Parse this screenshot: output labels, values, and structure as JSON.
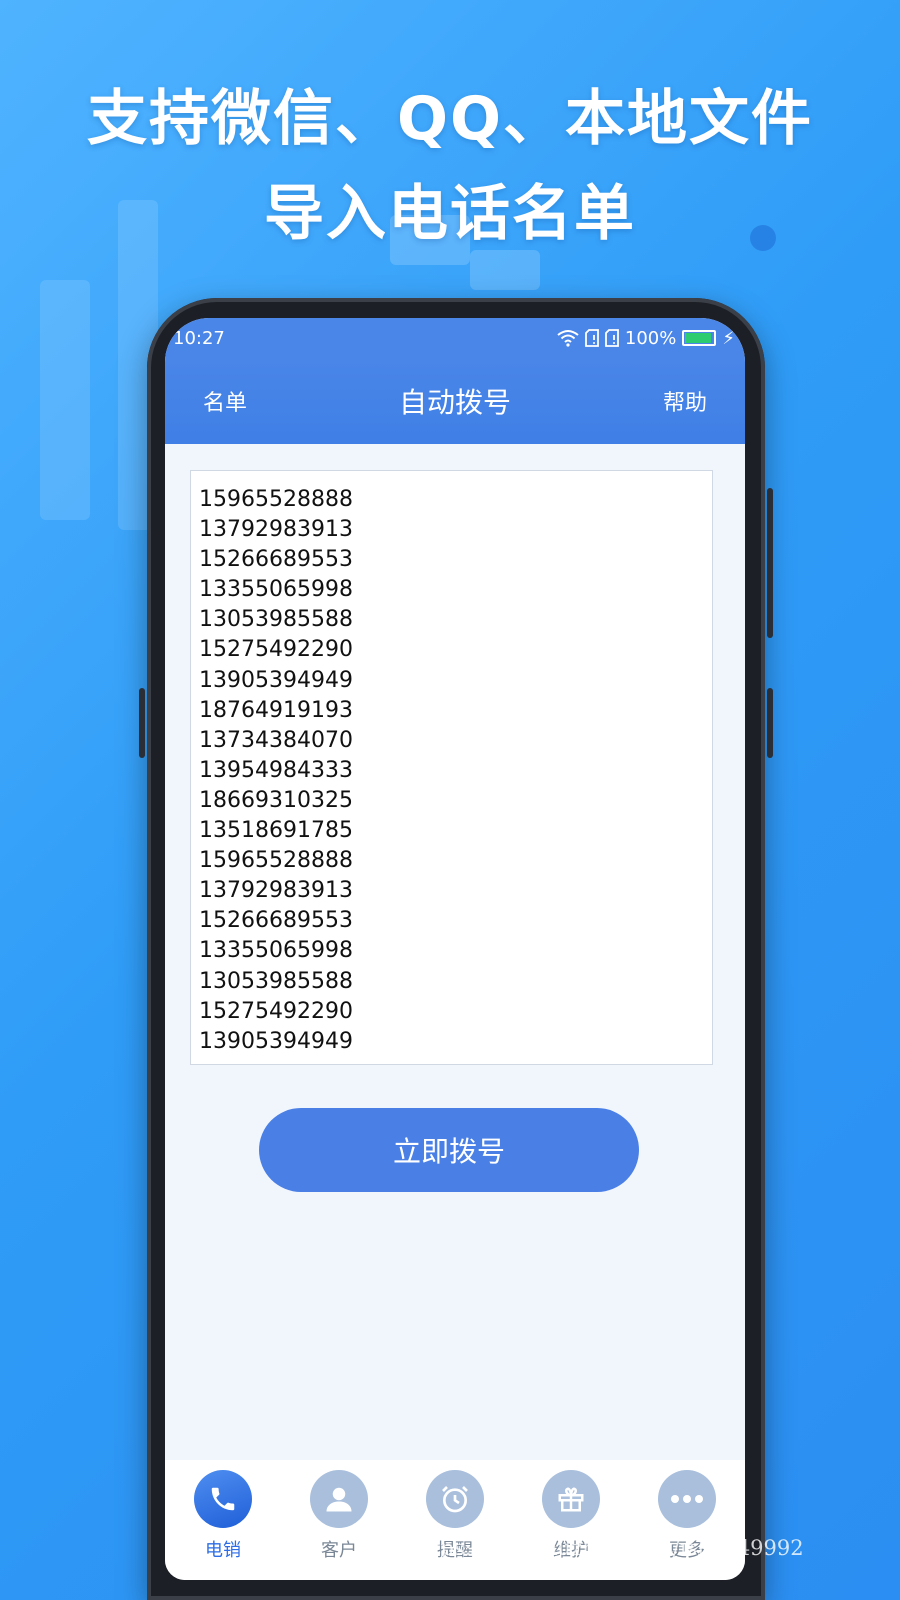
{
  "headline": {
    "line1": "支持微信、QQ、本地文件",
    "line2": "导入电话名单"
  },
  "status_bar": {
    "time": "10:27",
    "battery": "100%"
  },
  "app_bar": {
    "left": "名单",
    "title": "自动拨号",
    "right": "帮助"
  },
  "numbers": [
    "15965528888",
    "13792983913",
    "15266689553",
    "13355065998",
    "13053985588",
    "15275492290",
    "13905394949",
    "18764919193",
    "13734384070",
    "13954984333",
    "18669310325",
    "13518691785",
    "15965528888",
    "13792983913",
    "15266689553",
    "13355065998",
    "13053985588",
    "15275492290",
    "13905394949"
  ],
  "dial_button": "立即拨号",
  "tabs": [
    {
      "label": "电销",
      "icon": "phone-icon"
    },
    {
      "label": "客户",
      "icon": "person-icon"
    },
    {
      "label": "提醒",
      "icon": "alarm-clock-icon"
    },
    {
      "label": "维护",
      "icon": "gift-icon"
    },
    {
      "label": "更多",
      "icon": "more-icon"
    }
  ],
  "watermark": "https://www.huzhan.com/ishop49992",
  "colors": {
    "primary": "#4a86e8",
    "background_gradient_start": "#4fb3ff",
    "background_gradient_end": "#2b8ef2",
    "screen_bg": "#f1f6fd"
  }
}
